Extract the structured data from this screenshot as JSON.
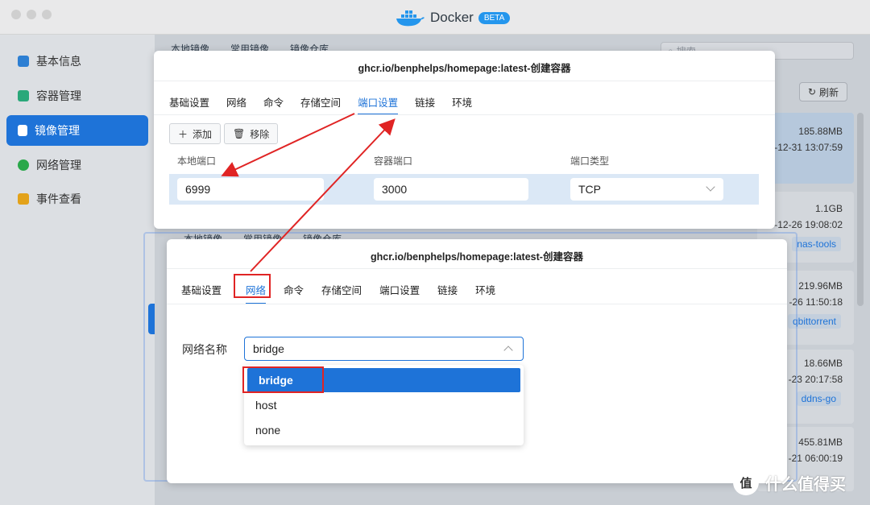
{
  "app": {
    "name": "Docker",
    "badge": "BETA"
  },
  "sidebar": {
    "items": [
      {
        "label": "基本信息",
        "icon": "docker-icon",
        "color": "#2d7fd3"
      },
      {
        "label": "容器管理",
        "icon": "cube-icon",
        "color": "#2aa87a"
      },
      {
        "label": "镜像管理",
        "icon": "image-icon",
        "color": "#ffffff"
      },
      {
        "label": "网络管理",
        "icon": "globe-icon",
        "color": "#2aa84a"
      },
      {
        "label": "事件查看",
        "icon": "calendar-icon",
        "color": "#e3a21a"
      }
    ]
  },
  "background": {
    "tabs": [
      "本地镜像",
      "常用镜像",
      "镜像仓库"
    ],
    "search_placeholder": "搜索",
    "refresh_label": "刷新",
    "images": [
      {
        "size": "185.88MB",
        "date": "-12-31 13:07:59",
        "tag": ""
      },
      {
        "size": "1.1GB",
        "date": "-12-26 19:08:02",
        "tag": "nas-tools"
      },
      {
        "size": "219.96MB",
        "date": "-26 11:50:18",
        "tag": "qbittorrent"
      },
      {
        "size": "18.66MB",
        "date": "-23 20:17:58",
        "tag": "ddns-go"
      },
      {
        "size": "455.81MB",
        "date": "-21 06:00:19",
        "tag": ""
      }
    ]
  },
  "dialog_ports": {
    "title": "ghcr.io/benphelps/homepage:latest-创建容器",
    "tabs": [
      "基础设置",
      "网络",
      "命令",
      "存储空间",
      "端口设置",
      "链接",
      "环境"
    ],
    "active_tab": "端口设置",
    "add_label": "添加",
    "remove_label": "移除",
    "columns": [
      "本地端口",
      "容器端口",
      "端口类型"
    ],
    "row": {
      "local_port": "6999",
      "container_port": "3000",
      "type": "TCP"
    }
  },
  "dialog_network": {
    "title": "ghcr.io/benphelps/homepage:latest-创建容器",
    "tabs": [
      "基础设置",
      "网络",
      "命令",
      "存储空间",
      "端口设置",
      "链接",
      "环境"
    ],
    "active_tab": "网络",
    "field_label": "网络名称",
    "selected_value": "bridge",
    "options": [
      "bridge",
      "host",
      "none"
    ]
  },
  "watermark": {
    "mark": "值",
    "text": "什么值得买"
  },
  "colors": {
    "accent": "#1e73d8",
    "annotation": "#e02424"
  }
}
